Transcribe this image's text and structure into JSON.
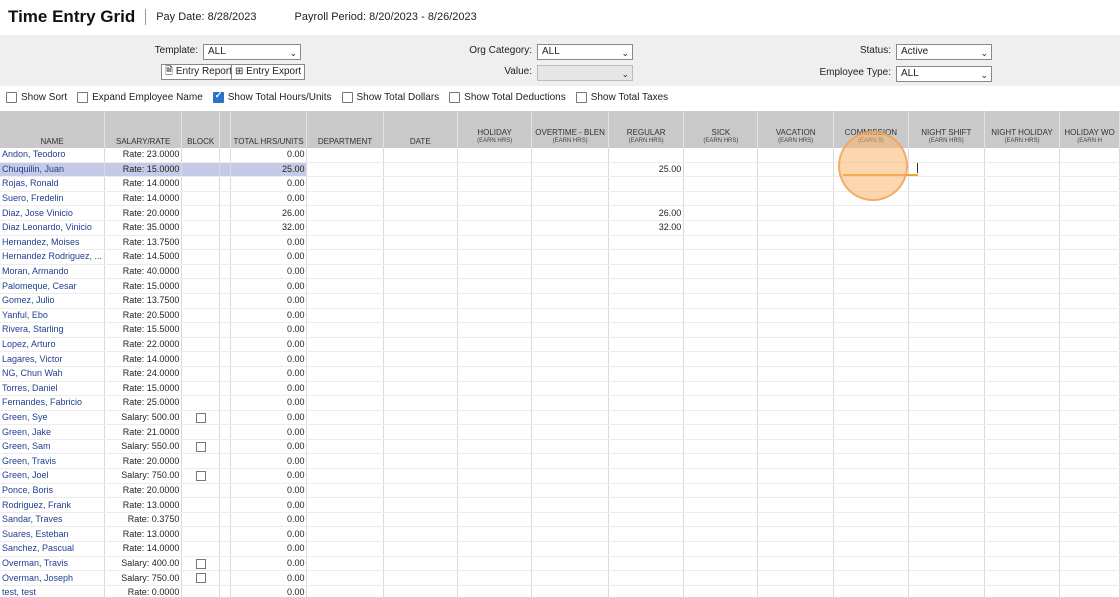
{
  "header": {
    "title": "Time Entry Grid",
    "pay_date": "Pay Date: 8/28/2023",
    "payroll_period": "Payroll Period: 8/20/2023 - 8/26/2023"
  },
  "filters": {
    "template_label": "Template:",
    "template_value": "ALL",
    "entry_report_label": "Entry Report",
    "entry_export_label": "Entry Export",
    "org_category_label": "Org Category:",
    "org_category_value": "ALL",
    "value_label": "Value:",
    "value_value": "",
    "status_label": "Status:",
    "status_value": "Active",
    "employee_type_label": "Employee Type:",
    "employee_type_value": "ALL"
  },
  "options": [
    {
      "label": "Show Sort",
      "checked": false
    },
    {
      "label": "Expand Employee Name",
      "checked": false
    },
    {
      "label": "Show Total Hours/Units",
      "checked": true
    },
    {
      "label": "Show Total Dollars",
      "checked": false
    },
    {
      "label": "Show Total Deductions",
      "checked": false
    },
    {
      "label": "Show Total Taxes",
      "checked": false
    }
  ],
  "columns": [
    {
      "label": "NAME",
      "sub": ""
    },
    {
      "label": "SALARY/RATE",
      "sub": ""
    },
    {
      "label": "BLOCK",
      "sub": ""
    },
    {
      "label": "",
      "sub": ""
    },
    {
      "label": "TOTAL HRS/UNITS",
      "sub": ""
    },
    {
      "label": "DEPARTMENT",
      "sub": ""
    },
    {
      "label": "DATE",
      "sub": ""
    },
    {
      "label": "HOLIDAY",
      "sub": "(EARN HRS)"
    },
    {
      "label": "OVERTIME - BLEN",
      "sub": "(EARN HRS)"
    },
    {
      "label": "REGULAR",
      "sub": "(EARN HRS)"
    },
    {
      "label": "SICK",
      "sub": "(EARN HRS)"
    },
    {
      "label": "VACATION",
      "sub": "(EARN HRS)"
    },
    {
      "label": "COMMISSION",
      "sub": "(EARN $)"
    },
    {
      "label": "NIGHT SHIFT",
      "sub": "(EARN HRS)"
    },
    {
      "label": "NIGHT HOLIDAY",
      "sub": "(EARN HRS)"
    },
    {
      "label": "HOLIDAY WO",
      "sub": "(EARN H"
    }
  ],
  "rows": [
    {
      "name": "Andon, Teodoro",
      "rate": "Rate: 23.0000",
      "block": false,
      "total": "0.00",
      "regular": ""
    },
    {
      "name": "Chuquilin, Juan",
      "rate": "Rate: 15.0000",
      "block": false,
      "total": "25.00",
      "regular": "25.00",
      "selected": true
    },
    {
      "name": "Rojas, Ronald",
      "rate": "Rate: 14.0000",
      "block": false,
      "total": "0.00",
      "regular": ""
    },
    {
      "name": "Suero, Fredelin",
      "rate": "Rate: 14.0000",
      "block": false,
      "total": "0.00",
      "regular": ""
    },
    {
      "name": "Diaz, Jose Vinicio",
      "rate": "Rate: 20.0000",
      "block": false,
      "total": "26.00",
      "regular": "26.00"
    },
    {
      "name": "Diaz Leonardo, Vinicio",
      "rate": "Rate: 35.0000",
      "block": false,
      "total": "32.00",
      "regular": "32.00"
    },
    {
      "name": "Hernandez, Moises",
      "rate": "Rate: 13.7500",
      "block": false,
      "total": "0.00",
      "regular": ""
    },
    {
      "name": "Hernandez Rodriguez, ...",
      "rate": "Rate: 14.5000",
      "block": false,
      "total": "0.00",
      "regular": ""
    },
    {
      "name": "Moran, Armando",
      "rate": "Rate: 40.0000",
      "block": false,
      "total": "0.00",
      "regular": ""
    },
    {
      "name": "Palomeque, Cesar",
      "rate": "Rate: 15.0000",
      "block": false,
      "total": "0.00",
      "regular": ""
    },
    {
      "name": "Gomez, Julio",
      "rate": "Rate: 13.7500",
      "block": false,
      "total": "0.00",
      "regular": ""
    },
    {
      "name": "Yanful, Ebo",
      "rate": "Rate: 20.5000",
      "block": false,
      "total": "0.00",
      "regular": ""
    },
    {
      "name": "Rivera, Starling",
      "rate": "Rate: 15.5000",
      "block": false,
      "total": "0.00",
      "regular": ""
    },
    {
      "name": "Lopez, Arturo",
      "rate": "Rate: 22.0000",
      "block": false,
      "total": "0.00",
      "regular": ""
    },
    {
      "name": "Lagares, Victor",
      "rate": "Rate: 14.0000",
      "block": false,
      "total": "0.00",
      "regular": ""
    },
    {
      "name": "NG, Chun Wah",
      "rate": "Rate: 24.0000",
      "block": false,
      "total": "0.00",
      "regular": ""
    },
    {
      "name": "Torres, Daniel",
      "rate": "Rate: 15.0000",
      "block": false,
      "total": "0.00",
      "regular": ""
    },
    {
      "name": "Fernandes, Fabricio",
      "rate": "Rate: 25.0000",
      "block": false,
      "total": "0.00",
      "regular": ""
    },
    {
      "name": "Green, Sye",
      "rate": "Salary: 500.00",
      "block": true,
      "total": "0.00",
      "regular": ""
    },
    {
      "name": "Green, Jake",
      "rate": "Rate: 21.0000",
      "block": false,
      "total": "0.00",
      "regular": ""
    },
    {
      "name": "Green, Sam",
      "rate": "Salary: 550.00",
      "block": true,
      "total": "0.00",
      "regular": ""
    },
    {
      "name": "Green, Travis",
      "rate": "Rate: 20.0000",
      "block": false,
      "total": "0.00",
      "regular": ""
    },
    {
      "name": "Green, Joel",
      "rate": "Salary: 750.00",
      "block": true,
      "total": "0.00",
      "regular": ""
    },
    {
      "name": "Ponce, Boris",
      "rate": "Rate: 20.0000",
      "block": false,
      "total": "0.00",
      "regular": ""
    },
    {
      "name": "Rodriguez, Frank",
      "rate": "Rate: 13.0000",
      "block": false,
      "total": "0.00",
      "regular": ""
    },
    {
      "name": "Sandar, Traves",
      "rate": "Rate: 0.3750",
      "block": false,
      "total": "0.00",
      "regular": ""
    },
    {
      "name": "Suares, Esteban",
      "rate": "Rate: 13.0000",
      "block": false,
      "total": "0.00",
      "regular": ""
    },
    {
      "name": "Sanchez, Pascual",
      "rate": "Rate: 14.0000",
      "block": false,
      "total": "0.00",
      "regular": ""
    },
    {
      "name": "Overman, Travis",
      "rate": "Salary: 400.00",
      "block": true,
      "total": "0.00",
      "regular": ""
    },
    {
      "name": "Overman, Joseph",
      "rate": "Salary: 750.00",
      "block": true,
      "total": "0.00",
      "regular": ""
    },
    {
      "name": "test, test",
      "rate": "Rate: 0.0000",
      "block": false,
      "total": "0.00",
      "regular": ""
    }
  ]
}
